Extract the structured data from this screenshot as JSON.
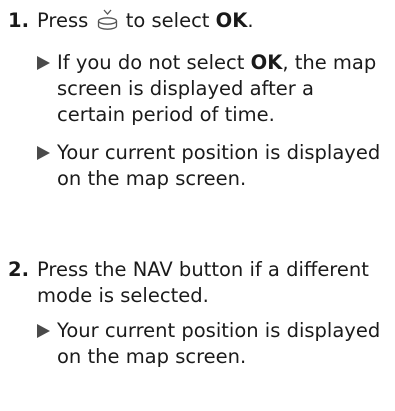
{
  "step1": {
    "number": "1.",
    "text_before": "Press",
    "icon": "interface-dial-push-icon",
    "text_after": "to select",
    "ok": "OK",
    "period": ".",
    "bullets": [
      {
        "prefix": "If you do not select",
        "ok": "OK",
        "suffix": ", the map screen is displayed after a certain period of time."
      },
      {
        "text": "Your current position is displayed on the map screen."
      }
    ]
  },
  "step2": {
    "number": "2.",
    "text": "Press the NAV button if a different mode is selected.",
    "bullets": [
      {
        "text": "Your current position is displayed on the map screen."
      }
    ]
  }
}
